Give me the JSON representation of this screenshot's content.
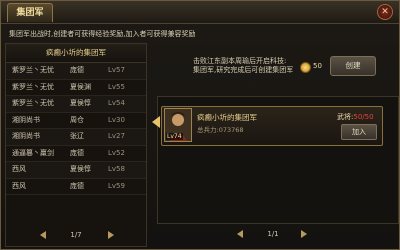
{
  "window": {
    "title": "集团军",
    "close_glyph": "✕"
  },
  "notice": "集团军出战时,创建者可获得经验奖励,加入者可获得兼容奖励",
  "left_panel": {
    "header": "疯癫小圻的集团军",
    "members": [
      {
        "name": "紫罗兰丶无忧",
        "general": "庞德",
        "level": "Lv57"
      },
      {
        "name": "紫罗兰丶无忧",
        "general": "夏侯渊",
        "level": "Lv55"
      },
      {
        "name": "紫罗兰丶无忧",
        "general": "夏侯惇",
        "level": "Lv54"
      },
      {
        "name": "湘阴尚书",
        "general": "周仓",
        "level": "Lv30"
      },
      {
        "name": "湘阴尚书",
        "general": "张辽",
        "level": "Lv27"
      },
      {
        "name": "通逼篡丶羸剑",
        "general": "庞德",
        "level": "Lv52"
      },
      {
        "name": "西风",
        "general": "夏侯惇",
        "level": "Lv58"
      },
      {
        "name": "西风",
        "general": "庞德",
        "level": "Lv59"
      }
    ],
    "pager": "1/7"
  },
  "right_panel": {
    "info_line1": "击败江东副本周瑜后开启科技:",
    "info_line2": "集团军,研究完成后可创建集团军",
    "coin_amount": "50",
    "create_label": "创建",
    "army": {
      "name": "疯癫小圻的集团军",
      "owner": "总兵力:073768",
      "level": "Lv74",
      "generals_label": "武将:",
      "generals_count": "50/50",
      "join_label": "加入"
    },
    "pager": "1/1"
  },
  "colors": {
    "accent": "#e6cf8c",
    "frame": "#8a6f3a",
    "alert": "#e0453a"
  }
}
